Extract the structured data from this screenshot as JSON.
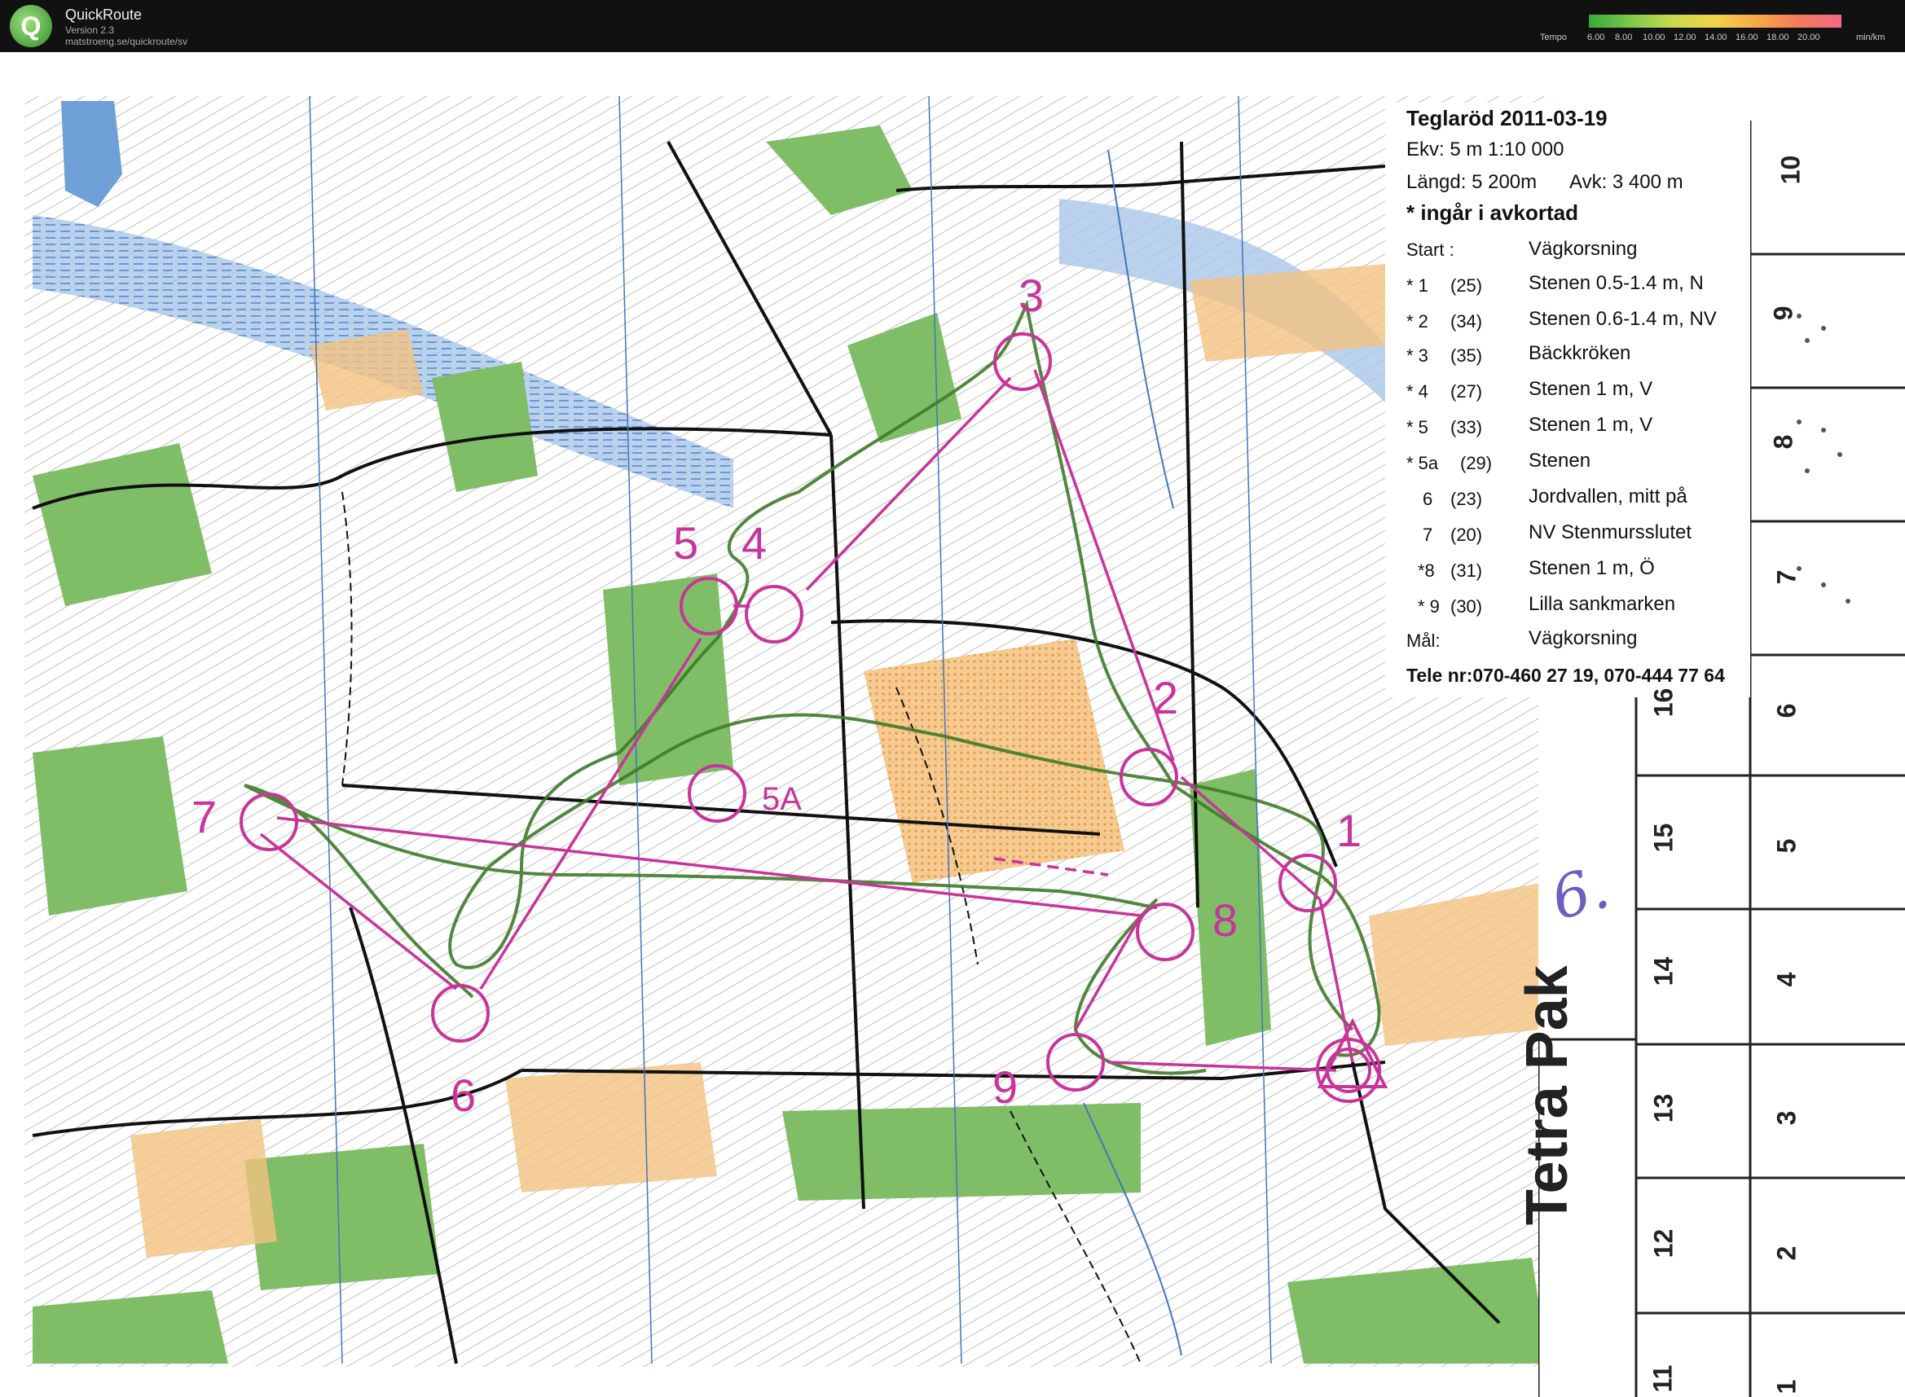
{
  "app": {
    "logo_letter": "Q",
    "name": "QuickRoute",
    "version": "Version 2.3",
    "url": "matstroeng.se/quickroute/sv"
  },
  "tempo_scale": {
    "label": "Tempo",
    "ticks": [
      "6.00",
      "8.00",
      "10.00",
      "12.00",
      "14.00",
      "16.00",
      "18.00",
      "20.00"
    ],
    "unit": "min/km"
  },
  "course": {
    "title": "Teglaröd 2011-03-19",
    "equidistance_scale": "Ekv: 5 m  1:10 000",
    "length": "Längd: 5 200m",
    "distance": "Avk: 3 400 m",
    "note": "* ingår i avkortad",
    "controls": [
      {
        "num": "Start :",
        "code": "",
        "desc": "Vägkorsning"
      },
      {
        "num": "*  1",
        "code": "(25)",
        "desc": "Stenen 0.5-1.4 m, N"
      },
      {
        "num": "*  2",
        "code": "(34)",
        "desc": "Stenen 0.6-1.4 m, NV"
      },
      {
        "num": "*  3",
        "code": "(35)",
        "desc": "Bäckkröken"
      },
      {
        "num": "*  4",
        "code": "(27)",
        "desc": "Stenen 1 m, V"
      },
      {
        "num": "*  5",
        "code": "(33)",
        "desc": "Stenen 1 m, V"
      },
      {
        "num": "*  5a",
        "code": "(29)",
        "desc": "Stenen"
      },
      {
        "num": "6",
        "code": "(23)",
        "desc": "Jordvallen, mitt på"
      },
      {
        "num": "7",
        "code": "(20)",
        "desc": "NV Stenmursslutet"
      },
      {
        "num": "*8",
        "code": "(31)",
        "desc": "Stenen 1 m, Ö"
      },
      {
        "num": "* 9",
        "code": "(30)",
        "desc": "Lilla sankmarken"
      },
      {
        "num": "Mål:",
        "code": "",
        "desc": "Vägkorsning"
      }
    ],
    "phone": "Tele nr:070-460 27 19, 070-444 77 64"
  },
  "map_labels": {
    "c1": "1",
    "c2": "2",
    "c3": "3",
    "c4": "4",
    "c5": "5",
    "c5a": "5A",
    "c6": "6",
    "c7": "7",
    "c8": "8",
    "c9": "9"
  },
  "punch_card": {
    "brand": "Tetra Pak",
    "handwritten": "6.",
    "col_a": [
      "10",
      "9",
      "8",
      "7",
      "6",
      "5",
      "4",
      "3",
      "2",
      "1"
    ],
    "col_b": [
      "16",
      "15",
      "14",
      "13",
      "12",
      "11"
    ]
  },
  "colors": {
    "course": "#c8349a",
    "route": "#3f7a2a",
    "forest": "#7fbe66",
    "open": "#f4c27f",
    "water": "#6e9fd6"
  }
}
